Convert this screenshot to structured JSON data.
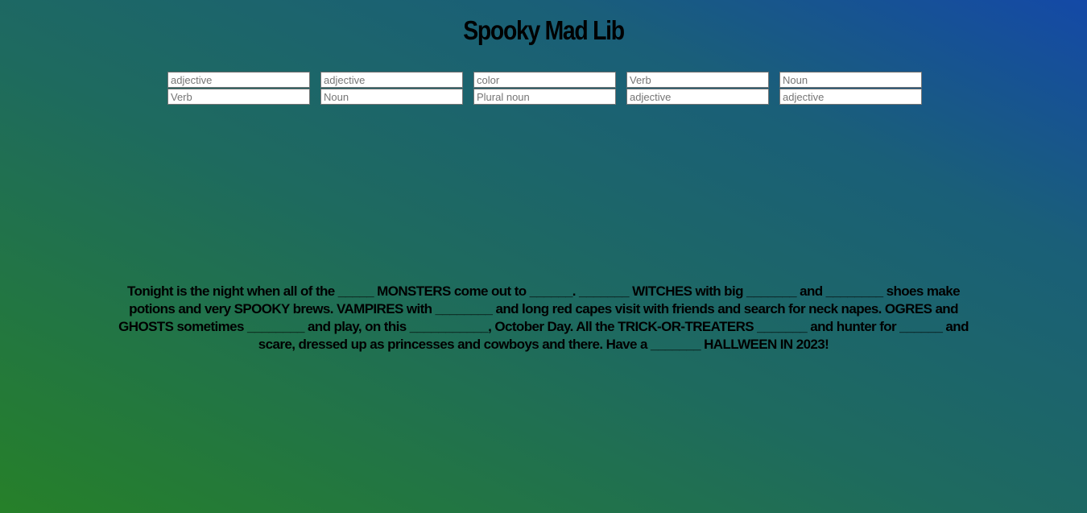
{
  "page": {
    "title": "Spooky Mad Lib"
  },
  "inputs": [
    {
      "placeholder": "adjective",
      "value": ""
    },
    {
      "placeholder": "adjective",
      "value": ""
    },
    {
      "placeholder": "color",
      "value": ""
    },
    {
      "placeholder": "Verb",
      "value": ""
    },
    {
      "placeholder": "Noun",
      "value": ""
    },
    {
      "placeholder": "Verb",
      "value": ""
    },
    {
      "placeholder": "Noun",
      "value": ""
    },
    {
      "placeholder": "Plural noun",
      "value": ""
    },
    {
      "placeholder": "adjective",
      "value": ""
    },
    {
      "placeholder": "adjective",
      "value": ""
    }
  ],
  "story": {
    "text": "Tonight is the night when all of the _____ MONSTERS come out to ______. _______ WITCHES with big _______ and ________ shoes make potions and very SPOOKY brews. VAMPIRES with ________ and long red capes visit with friends and search for neck napes. OGRES and GHOSTS sometimes ________ and play, on this ___________, October Day. All the TRICK-OR-TREATERS _______ and hunter for ______ and scare, dressed up as princesses and cowboys and there. Have a _______ HALLWEEN IN 2023!"
  },
  "colors": {
    "gradient_bottom_left": "#268029",
    "gradient_top_right": "#1449a7",
    "text": "#000000"
  }
}
